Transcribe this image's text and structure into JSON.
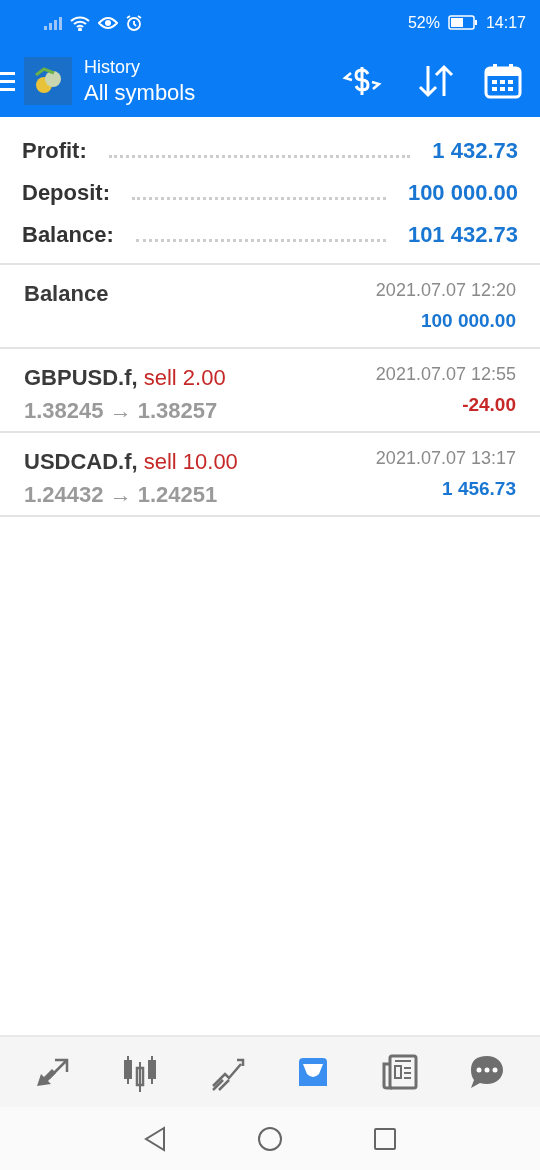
{
  "status_bar": {
    "battery": "52%",
    "time": "14:17"
  },
  "header": {
    "title": "History",
    "subtitle": "All symbols"
  },
  "summary": [
    {
      "label": "Profit:",
      "value": "1 432.73"
    },
    {
      "label": "Deposit:",
      "value": "100 000.00"
    },
    {
      "label": "Balance:",
      "value": "101 432.73"
    }
  ],
  "deals": [
    {
      "kind": "balance",
      "title": "Balance",
      "time": "2021.07.07 12:20",
      "amount": "100 000.00",
      "color": "#1976d2"
    },
    {
      "kind": "trade",
      "symbol": "GBPUSD.f,",
      "side": "sell 2.00",
      "prices": "1.38245 → 1.38257",
      "time": "2021.07.07 12:55",
      "amount": "-24.00",
      "color": "#c62828"
    },
    {
      "kind": "trade",
      "symbol": "USDCAD.f,",
      "side": "sell 10.00",
      "prices": "1.24432 → 1.24251",
      "time": "2021.07.07 13:17",
      "amount": "1 456.73",
      "color": "#1976d2"
    }
  ],
  "bottom_nav": [
    {
      "kind": "trade",
      "selected": false
    },
    {
      "kind": "quotes",
      "selected": false
    },
    {
      "kind": "chart",
      "selected": false
    },
    {
      "kind": "history",
      "selected": true
    },
    {
      "kind": "news",
      "selected": false
    },
    {
      "kind": "chat",
      "selected": false
    }
  ]
}
